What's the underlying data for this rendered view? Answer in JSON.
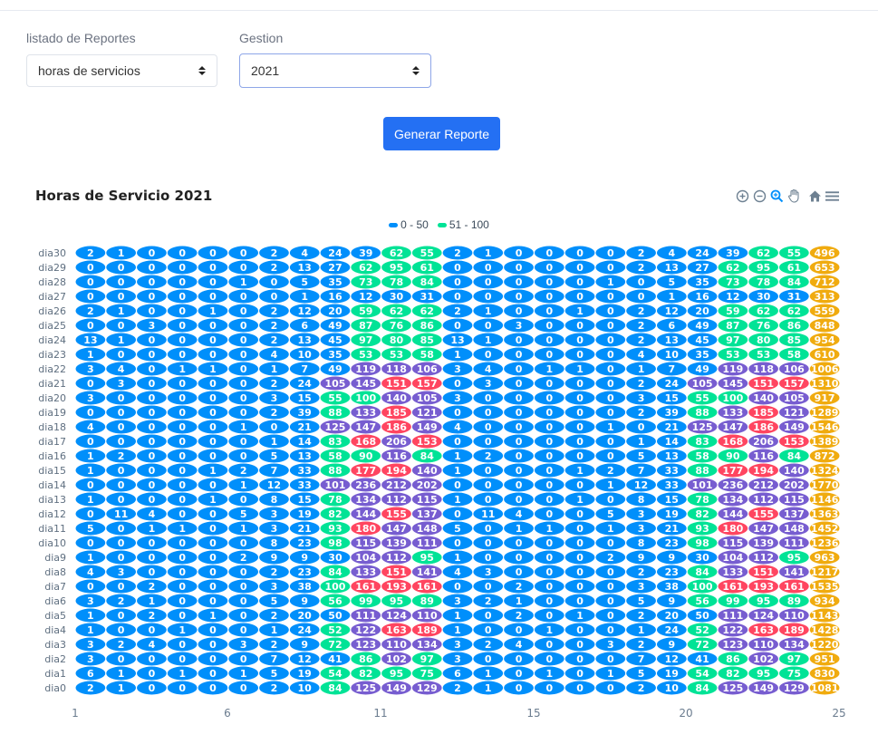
{
  "form": {
    "report_label": "listado de Reportes",
    "report_value": "horas de servicios",
    "year_label": "Gestion",
    "year_value": "2021",
    "generate_label": "Generar Reporte"
  },
  "toolbar_icons": [
    "zoom-in-icon",
    "zoom-out-icon",
    "selection-zoom-icon",
    "pan-icon",
    "home-icon",
    "menu-icon"
  ],
  "chart_data": {
    "type": "heatmap",
    "title": "Horas de Servicio 2021",
    "legend": [
      {
        "name": "0 - 50",
        "color": "#008ffb"
      },
      {
        "name": "51 - 100",
        "color": "#00e396"
      }
    ],
    "ranges": [
      {
        "from": 0,
        "to": 50,
        "color": "#008ffb"
      },
      {
        "from": 51,
        "to": 100,
        "color": "#00e396"
      },
      {
        "from": 101,
        "to": 150,
        "color": "#775dd0"
      },
      {
        "from": 151,
        "to": 200,
        "color": "#ff4560"
      },
      {
        "from": 201,
        "to": 250,
        "color": "#775dd0"
      }
    ],
    "x_ticks": [
      "1",
      "6",
      "11",
      "15",
      "20",
      "25"
    ],
    "rows": [
      {
        "name": "dia30",
        "values": [
          2,
          1,
          0,
          0,
          0,
          0,
          2,
          4,
          24,
          39,
          62,
          55,
          2,
          1,
          0,
          0,
          0,
          0,
          2,
          4,
          24,
          39,
          62,
          55,
          496
        ]
      },
      {
        "name": "dia29",
        "values": [
          0,
          0,
          0,
          0,
          0,
          0,
          2,
          13,
          27,
          62,
          95,
          61,
          0,
          0,
          0,
          0,
          0,
          0,
          2,
          13,
          27,
          62,
          95,
          61,
          653
        ]
      },
      {
        "name": "dia28",
        "values": [
          0,
          0,
          0,
          0,
          0,
          1,
          0,
          5,
          35,
          73,
          78,
          84,
          0,
          0,
          0,
          0,
          0,
          1,
          0,
          5,
          35,
          73,
          78,
          84,
          712
        ]
      },
      {
        "name": "dia27",
        "values": [
          0,
          0,
          0,
          0,
          0,
          0,
          0,
          1,
          16,
          12,
          30,
          31,
          0,
          0,
          0,
          0,
          0,
          0,
          0,
          1,
          16,
          12,
          30,
          31,
          313
        ]
      },
      {
        "name": "dia26",
        "values": [
          2,
          1,
          0,
          0,
          1,
          0,
          2,
          12,
          20,
          59,
          62,
          62,
          2,
          1,
          0,
          0,
          1,
          0,
          2,
          12,
          20,
          59,
          62,
          62,
          559
        ]
      },
      {
        "name": "dia25",
        "values": [
          0,
          0,
          3,
          0,
          0,
          0,
          2,
          6,
          49,
          87,
          76,
          86,
          0,
          0,
          3,
          0,
          0,
          0,
          2,
          6,
          49,
          87,
          76,
          86,
          848
        ]
      },
      {
        "name": "dia24",
        "values": [
          13,
          1,
          0,
          0,
          0,
          0,
          2,
          13,
          45,
          97,
          80,
          85,
          13,
          1,
          0,
          0,
          0,
          0,
          2,
          13,
          45,
          97,
          80,
          85,
          954
        ]
      },
      {
        "name": "dia23",
        "values": [
          1,
          0,
          0,
          0,
          0,
          0,
          4,
          10,
          35,
          53,
          53,
          58,
          1,
          0,
          0,
          0,
          0,
          0,
          4,
          10,
          35,
          53,
          53,
          58,
          610
        ]
      },
      {
        "name": "dia22",
        "values": [
          3,
          4,
          0,
          1,
          1,
          0,
          1,
          7,
          49,
          119,
          118,
          106,
          3,
          4,
          0,
          1,
          1,
          0,
          1,
          7,
          49,
          119,
          118,
          106,
          1006
        ]
      },
      {
        "name": "dia21",
        "values": [
          0,
          3,
          0,
          0,
          0,
          0,
          2,
          24,
          105,
          145,
          151,
          157,
          0,
          3,
          0,
          0,
          0,
          0,
          2,
          24,
          105,
          145,
          151,
          157,
          1310
        ]
      },
      {
        "name": "dia20",
        "values": [
          3,
          0,
          0,
          0,
          0,
          0,
          3,
          15,
          55,
          100,
          140,
          105,
          3,
          0,
          0,
          0,
          0,
          0,
          3,
          15,
          55,
          100,
          140,
          105,
          917
        ]
      },
      {
        "name": "dia19",
        "values": [
          0,
          0,
          0,
          0,
          0,
          0,
          2,
          39,
          88,
          133,
          185,
          121,
          0,
          0,
          0,
          0,
          0,
          0,
          2,
          39,
          88,
          133,
          185,
          121,
          1289
        ]
      },
      {
        "name": "dia18",
        "values": [
          4,
          0,
          0,
          0,
          0,
          1,
          0,
          21,
          125,
          147,
          186,
          149,
          4,
          0,
          0,
          0,
          0,
          1,
          0,
          21,
          125,
          147,
          186,
          149,
          1546
        ]
      },
      {
        "name": "dia17",
        "values": [
          0,
          0,
          0,
          0,
          0,
          0,
          1,
          14,
          83,
          168,
          206,
          153,
          0,
          0,
          0,
          0,
          0,
          0,
          1,
          14,
          83,
          168,
          206,
          153,
          1389
        ]
      },
      {
        "name": "dia16",
        "values": [
          1,
          2,
          0,
          0,
          0,
          0,
          5,
          13,
          58,
          90,
          116,
          84,
          1,
          2,
          0,
          0,
          0,
          0,
          5,
          13,
          58,
          90,
          116,
          84,
          872
        ]
      },
      {
        "name": "dia15",
        "values": [
          1,
          0,
          0,
          0,
          1,
          2,
          7,
          33,
          88,
          177,
          194,
          140,
          1,
          0,
          0,
          0,
          1,
          2,
          7,
          33,
          88,
          177,
          194,
          140,
          1324
        ]
      },
      {
        "name": "dia14",
        "values": [
          0,
          0,
          0,
          0,
          0,
          1,
          12,
          33,
          101,
          236,
          212,
          202,
          0,
          0,
          0,
          0,
          0,
          1,
          12,
          33,
          101,
          236,
          212,
          202,
          1770
        ]
      },
      {
        "name": "dia13",
        "values": [
          1,
          0,
          0,
          0,
          1,
          0,
          8,
          15,
          78,
          134,
          112,
          115,
          1,
          0,
          0,
          0,
          1,
          0,
          8,
          15,
          78,
          134,
          112,
          115,
          1146
        ]
      },
      {
        "name": "dia12",
        "values": [
          0,
          11,
          4,
          0,
          0,
          5,
          3,
          19,
          82,
          144,
          155,
          137,
          0,
          11,
          4,
          0,
          0,
          5,
          3,
          19,
          82,
          144,
          155,
          137,
          1363
        ]
      },
      {
        "name": "dia11",
        "values": [
          5,
          0,
          1,
          1,
          0,
          1,
          3,
          21,
          93,
          180,
          147,
          148,
          5,
          0,
          1,
          1,
          0,
          1,
          3,
          21,
          93,
          180,
          147,
          148,
          1452
        ]
      },
      {
        "name": "dia10",
        "values": [
          0,
          0,
          0,
          0,
          0,
          0,
          8,
          23,
          98,
          115,
          139,
          111,
          0,
          0,
          0,
          0,
          0,
          0,
          8,
          23,
          98,
          115,
          139,
          111,
          1236
        ]
      },
      {
        "name": "dia9",
        "values": [
          1,
          0,
          0,
          0,
          0,
          2,
          9,
          9,
          30,
          104,
          112,
          95,
          1,
          0,
          0,
          0,
          0,
          2,
          9,
          9,
          30,
          104,
          112,
          95,
          963
        ]
      },
      {
        "name": "dia8",
        "values": [
          4,
          3,
          0,
          0,
          0,
          0,
          2,
          23,
          84,
          133,
          151,
          141,
          4,
          3,
          0,
          0,
          0,
          0,
          2,
          23,
          84,
          133,
          151,
          141,
          1217
        ]
      },
      {
        "name": "dia7",
        "values": [
          0,
          0,
          2,
          0,
          0,
          0,
          3,
          38,
          100,
          161,
          193,
          161,
          0,
          0,
          2,
          0,
          0,
          0,
          3,
          38,
          100,
          161,
          193,
          161,
          1535
        ]
      },
      {
        "name": "dia6",
        "values": [
          3,
          2,
          1,
          0,
          0,
          0,
          5,
          9,
          56,
          99,
          95,
          89,
          3,
          2,
          1,
          0,
          0,
          0,
          5,
          9,
          56,
          99,
          95,
          89,
          934
        ]
      },
      {
        "name": "dia5",
        "values": [
          1,
          0,
          2,
          0,
          1,
          0,
          2,
          20,
          50,
          111,
          124,
          110,
          1,
          0,
          2,
          0,
          1,
          0,
          2,
          20,
          50,
          111,
          124,
          110,
          1143
        ]
      },
      {
        "name": "dia4",
        "values": [
          1,
          0,
          0,
          1,
          0,
          0,
          1,
          24,
          52,
          122,
          163,
          189,
          1,
          0,
          0,
          1,
          0,
          0,
          1,
          24,
          52,
          122,
          163,
          189,
          1428
        ]
      },
      {
        "name": "dia3",
        "values": [
          3,
          2,
          4,
          0,
          0,
          3,
          2,
          9,
          72,
          123,
          110,
          134,
          3,
          2,
          4,
          0,
          0,
          3,
          2,
          9,
          72,
          123,
          110,
          134,
          1220
        ]
      },
      {
        "name": "dia2",
        "values": [
          3,
          0,
          0,
          0,
          0,
          0,
          7,
          12,
          41,
          86,
          102,
          97,
          3,
          0,
          0,
          0,
          0,
          0,
          7,
          12,
          41,
          86,
          102,
          97,
          951
        ]
      },
      {
        "name": "dia1",
        "values": [
          6,
          1,
          0,
          1,
          0,
          1,
          5,
          19,
          54,
          82,
          95,
          75,
          6,
          1,
          0,
          1,
          0,
          1,
          5,
          19,
          54,
          82,
          95,
          75,
          830
        ]
      },
      {
        "name": "dia0",
        "values": [
          2,
          1,
          0,
          0,
          0,
          0,
          2,
          10,
          84,
          125,
          149,
          129,
          2,
          1,
          0,
          0,
          0,
          0,
          2,
          10,
          84,
          125,
          149,
          129,
          1081
        ]
      }
    ]
  }
}
